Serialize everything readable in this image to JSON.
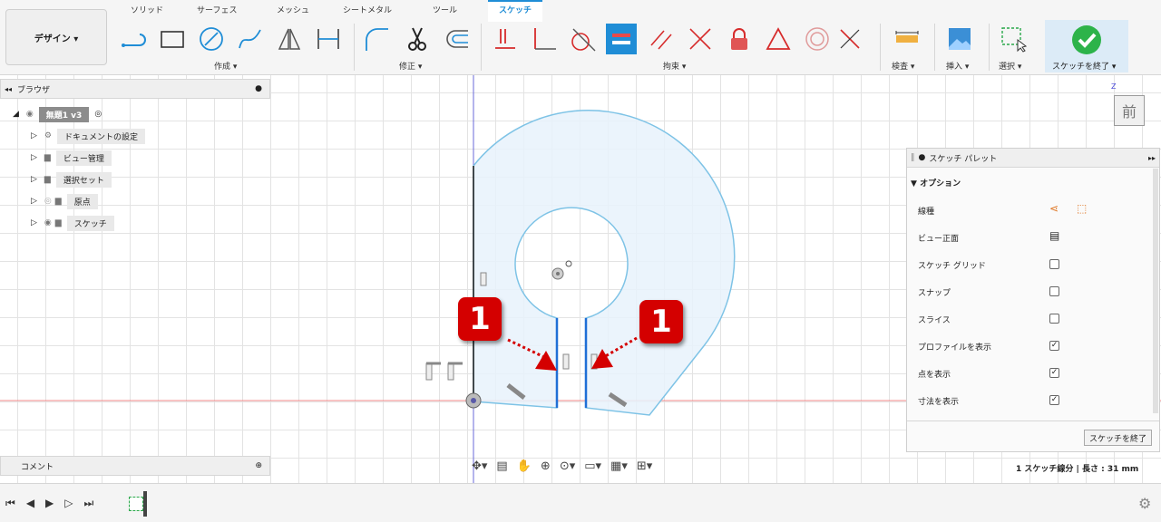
{
  "design_menu": "デザイン ▾",
  "tabs": [
    "ソリッド",
    "サーフェス",
    "メッシュ",
    "シートメタル",
    "ツール",
    "スケッチ"
  ],
  "groups": {
    "create": "作成 ▾",
    "modify": "修正 ▾",
    "constraints": "拘束 ▾",
    "inspect": "検査 ▾",
    "insert": "挿入 ▾",
    "select": "選択 ▾",
    "finish": "スケッチを終了 ▾"
  },
  "browser": {
    "title": "ブラウザ",
    "root": "無題1 v3",
    "items": [
      "ドキュメントの設定",
      "ビュー管理",
      "選択セット",
      "原点",
      "スケッチ"
    ]
  },
  "viewcube": {
    "face": "前",
    "axis": "Z"
  },
  "palette": {
    "title": "スケッチ パレット",
    "section": "オプション",
    "rows": [
      {
        "label": "線種",
        "control": "icons"
      },
      {
        "label": "ビュー正面",
        "control": "icon"
      },
      {
        "label": "スケッチ グリッド",
        "checked": false
      },
      {
        "label": "スナップ",
        "checked": false
      },
      {
        "label": "スライス",
        "checked": false
      },
      {
        "label": "プロファイルを表示",
        "checked": true
      },
      {
        "label": "点を表示",
        "checked": true
      },
      {
        "label": "寸法を表示",
        "checked": true
      }
    ],
    "finish_button": "スケッチを終了"
  },
  "comment": "コメント",
  "status": "1 スケッチ線分 | 長さ : 31 mm",
  "callouts": [
    "1",
    "1"
  ],
  "colors": {
    "accent": "#1f8dd6",
    "profile_fill": "#e8f2fb",
    "profile_stroke": "#7ec3e6",
    "callout": "#d40000"
  }
}
